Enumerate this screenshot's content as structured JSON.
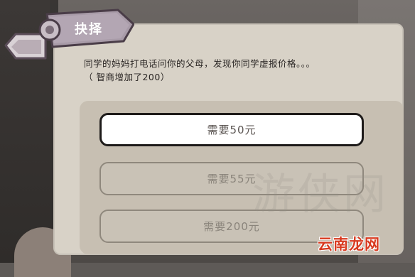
{
  "dialog": {
    "title": "抉择",
    "message_line1": "同学的妈妈打电话问你的父母，发现你同学虚报价格。。。",
    "message_line2": "（ 智商增加了200）"
  },
  "options": [
    {
      "label": "需要50元",
      "state": "active"
    },
    {
      "label": "需要55元",
      "state": "disabled"
    },
    {
      "label": "需要200元",
      "state": "disabled"
    }
  ],
  "watermark": {
    "text": "游侠网",
    "site_logo": "云南龙网"
  },
  "colors": {
    "panel": "#d8d2c7",
    "options_area": "#c7bfb2",
    "tag": "#a89ba8",
    "site_logo": "#d83a1f"
  }
}
